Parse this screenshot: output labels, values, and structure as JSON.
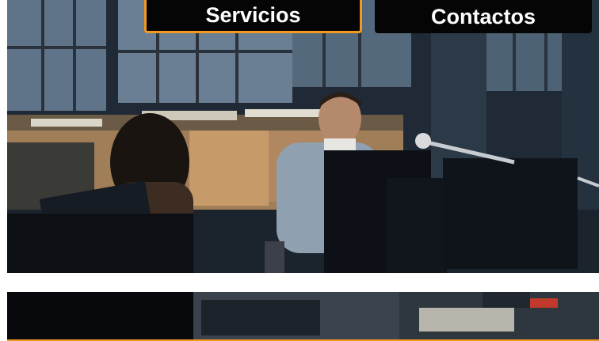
{
  "nav": {
    "servicios_label": "Servicios",
    "contactos_label": "Contactos"
  },
  "colors": {
    "accent": "#f39a1e",
    "nav_bg": "#050505",
    "nav_text": "#ffffff"
  },
  "images": {
    "hero": "office-photo",
    "secondary": "desk-photo"
  }
}
